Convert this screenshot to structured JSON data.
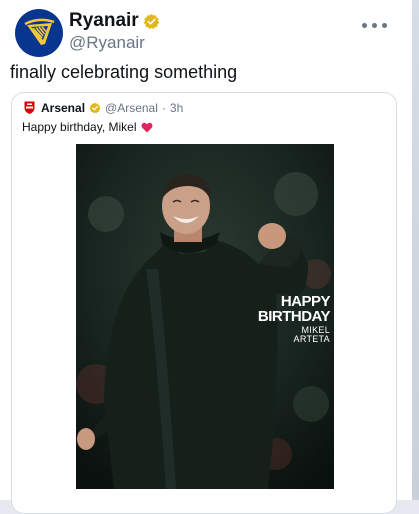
{
  "colors": {
    "ryanair_blue": "#073590",
    "ryanair_gold": "#f1c933",
    "verified_gold": "#e2b719",
    "arsenal_red": "#db0007",
    "heart_red": "#e0245e"
  },
  "tweet": {
    "author_name": "Ryanair",
    "author_handle": "@Ryanair",
    "text": "finally celebrating something",
    "avatar_icon": "ryanair-harp-logo",
    "more_icon": "ellipsis-icon"
  },
  "quoted": {
    "author_name": "Arsenal",
    "author_handle": "@Arsenal",
    "separator": "·",
    "time": "3h",
    "text": "Happy birthday, Mikel",
    "emoji": "red-heart",
    "image": {
      "line1": "HAPPY",
      "line2": "BIRTHDAY",
      "line3": "MIKEL",
      "line4": "ARTETA"
    }
  }
}
